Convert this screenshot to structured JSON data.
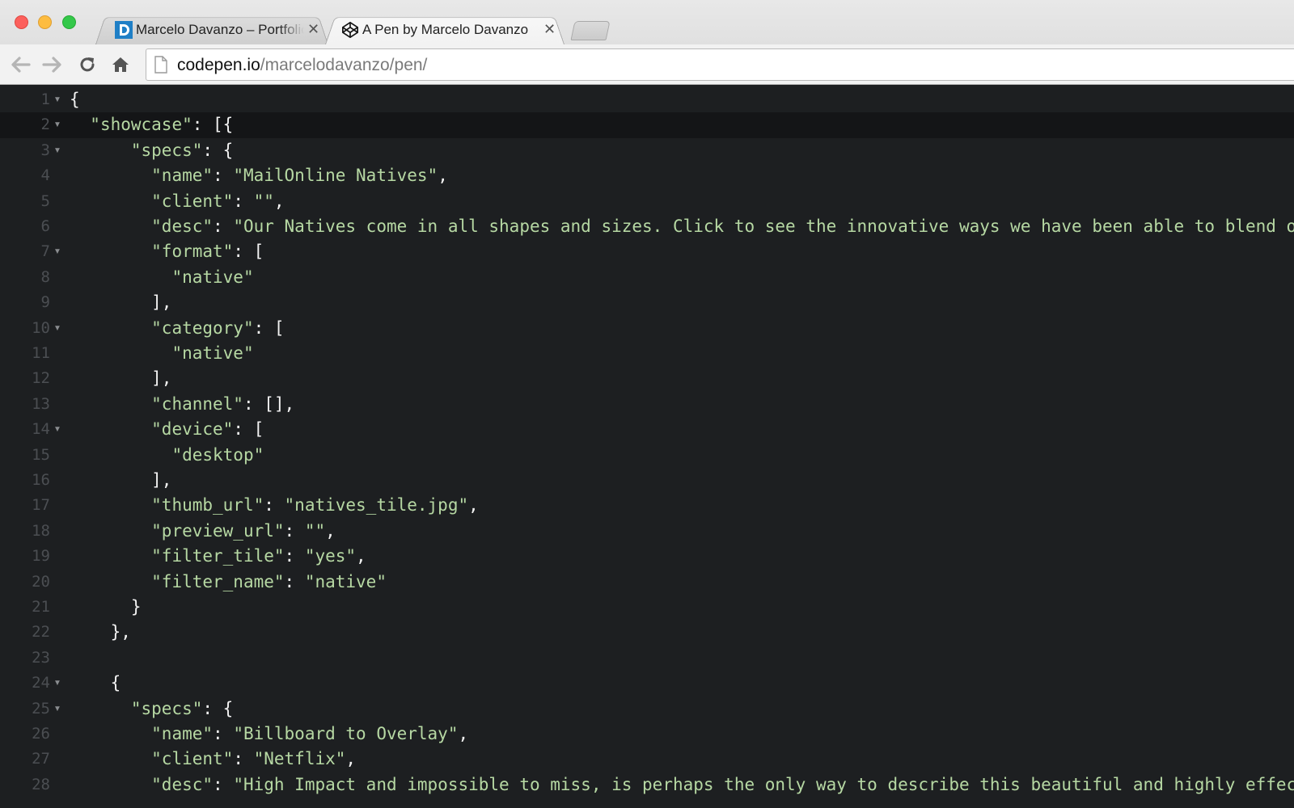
{
  "tabs": [
    {
      "title": "Marcelo Davanzo – Portfolio",
      "favicon": "d-logo-icon",
      "active": false
    },
    {
      "title": "A Pen by Marcelo Davanzo",
      "favicon": "codepen-icon",
      "active": true
    }
  ],
  "close_glyph": "✕",
  "address": {
    "host": "codepen.io",
    "path": "/marcelodavanzo/pen/"
  },
  "editor": {
    "lines": [
      {
        "n": "1",
        "fold": true,
        "indent": "",
        "text": "{"
      },
      {
        "n": "2",
        "fold": true,
        "indent": "  ",
        "key": "\"showcase\"",
        "rest": ": [{",
        "active": true
      },
      {
        "n": "3",
        "fold": true,
        "indent": "      ",
        "key": "\"specs\"",
        "rest": ": {"
      },
      {
        "n": "4",
        "fold": false,
        "indent": "        ",
        "key": "\"name\"",
        "rest": ": ",
        "value": "\"MailOnline Natives\"",
        "tail": ","
      },
      {
        "n": "5",
        "fold": false,
        "indent": "        ",
        "key": "\"client\"",
        "rest": ": ",
        "value": "\"\"",
        "tail": ","
      },
      {
        "n": "6",
        "fold": false,
        "indent": "        ",
        "key": "\"desc\"",
        "rest": ": ",
        "value": "\"Our Natives come in all shapes and sizes. Click to see the innovative ways we have been able to blend ou",
        "tail": ""
      },
      {
        "n": "7",
        "fold": true,
        "indent": "        ",
        "key": "\"format\"",
        "rest": ": ["
      },
      {
        "n": "8",
        "fold": false,
        "indent": "          ",
        "value": "\"native\""
      },
      {
        "n": "9",
        "fold": false,
        "indent": "        ",
        "text": "],"
      },
      {
        "n": "10",
        "fold": true,
        "indent": "        ",
        "key": "\"category\"",
        "rest": ": ["
      },
      {
        "n": "11",
        "fold": false,
        "indent": "          ",
        "value": "\"native\""
      },
      {
        "n": "12",
        "fold": false,
        "indent": "        ",
        "text": "],"
      },
      {
        "n": "13",
        "fold": false,
        "indent": "        ",
        "key": "\"channel\"",
        "rest": ": [],"
      },
      {
        "n": "14",
        "fold": true,
        "indent": "        ",
        "key": "\"device\"",
        "rest": ": ["
      },
      {
        "n": "15",
        "fold": false,
        "indent": "          ",
        "value": "\"desktop\""
      },
      {
        "n": "16",
        "fold": false,
        "indent": "        ",
        "text": "],"
      },
      {
        "n": "17",
        "fold": false,
        "indent": "        ",
        "key": "\"thumb_url\"",
        "rest": ": ",
        "value": "\"natives_tile.jpg\"",
        "tail": ","
      },
      {
        "n": "18",
        "fold": false,
        "indent": "        ",
        "key": "\"preview_url\"",
        "rest": ": ",
        "value": "\"\"",
        "tail": ","
      },
      {
        "n": "19",
        "fold": false,
        "indent": "        ",
        "key": "\"filter_tile\"",
        "rest": ": ",
        "value": "\"yes\"",
        "tail": ","
      },
      {
        "n": "20",
        "fold": false,
        "indent": "        ",
        "key": "\"filter_name\"",
        "rest": ": ",
        "value": "\"native\"",
        "tail": ""
      },
      {
        "n": "21",
        "fold": false,
        "indent": "      ",
        "text": "}"
      },
      {
        "n": "22",
        "fold": false,
        "indent": "    ",
        "text": "},"
      },
      {
        "n": "23",
        "fold": false,
        "indent": "",
        "text": ""
      },
      {
        "n": "24",
        "fold": true,
        "indent": "    ",
        "text": "{"
      },
      {
        "n": "25",
        "fold": true,
        "indent": "      ",
        "key": "\"specs\"",
        "rest": ": {"
      },
      {
        "n": "26",
        "fold": false,
        "indent": "        ",
        "key": "\"name\"",
        "rest": ": ",
        "value": "\"Billboard to Overlay\"",
        "tail": ","
      },
      {
        "n": "27",
        "fold": false,
        "indent": "        ",
        "key": "\"client\"",
        "rest": ": ",
        "value": "\"Netflix\"",
        "tail": ","
      },
      {
        "n": "28",
        "fold": false,
        "indent": "        ",
        "key": "\"desc\"",
        "rest": ": ",
        "value": "\"High Impact and impossible to miss, is perhaps the only way to describe this beautiful and highly effec",
        "tail": ""
      }
    ]
  },
  "colors": {
    "editor_bg": "#1d1f21",
    "string": "#b6d8a3",
    "gutter": "#4b4e52"
  }
}
